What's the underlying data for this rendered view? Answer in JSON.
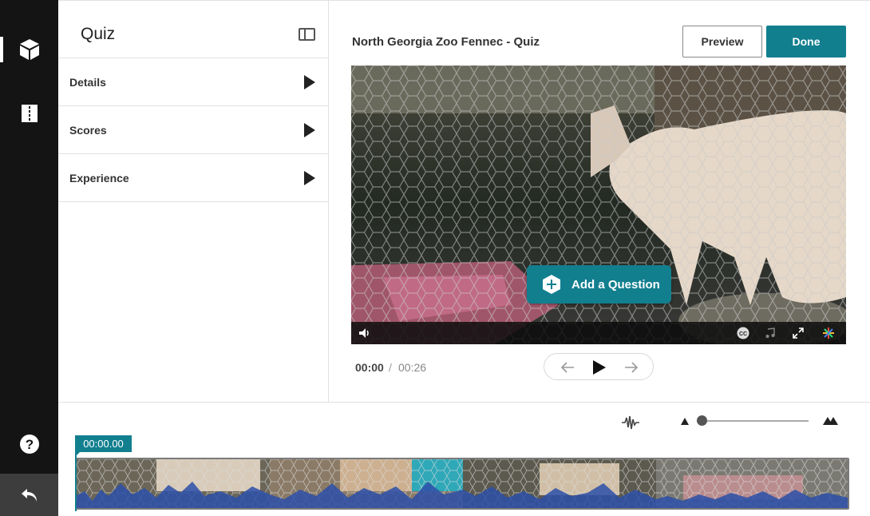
{
  "rail": {
    "items": [
      {
        "name": "quiz-cube-icon",
        "active": true
      },
      {
        "name": "chapters-icon",
        "active": false
      }
    ],
    "help_icon": "help-icon",
    "back_icon": "back-icon"
  },
  "panel": {
    "title": "Quiz",
    "sections": [
      {
        "label": "Details"
      },
      {
        "label": "Scores"
      },
      {
        "label": "Experience"
      }
    ]
  },
  "header": {
    "video_title": "North Georgia Zoo Fennec - Quiz",
    "preview_label": "Preview",
    "done_label": "Done"
  },
  "player": {
    "add_question_label": "Add a Question",
    "cc_label": "CC",
    "current_time": "00:00",
    "separator": "/",
    "duration": "00:26"
  },
  "timeline": {
    "position_badge": "00:00.00",
    "zoom_level": 0
  },
  "colors": {
    "accent": "#127f8f",
    "rail": "#141414",
    "waveform": "#2b4fa8"
  }
}
